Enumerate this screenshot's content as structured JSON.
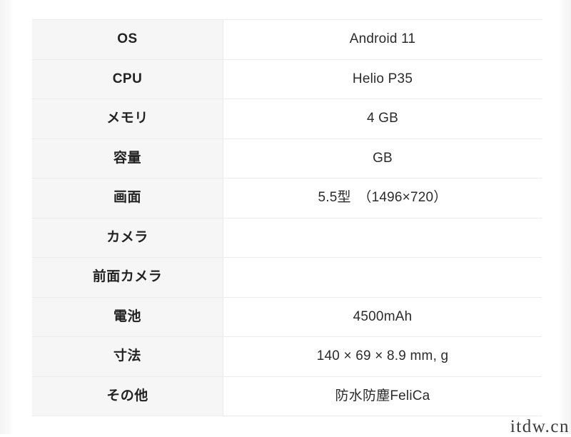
{
  "table": {
    "rows": [
      {
        "label": "OS",
        "value": "Android 11"
      },
      {
        "label": "CPU",
        "value": "Helio P35"
      },
      {
        "label": "メモリ",
        "value": "4 GB"
      },
      {
        "label": "容量",
        "value": "GB"
      },
      {
        "label": "画面",
        "value": "5.5型　（1496×720）"
      },
      {
        "label": "カメラ",
        "value": ""
      },
      {
        "label": "前面カメラ",
        "value": ""
      },
      {
        "label": "電池",
        "value": "4500mAh"
      },
      {
        "label": "寸法",
        "value": "140 × 69 × 8.9 mm, g"
      },
      {
        "label": "その他",
        "value": "防水防塵FeliCa"
      }
    ]
  },
  "watermark": {
    "text": "itdw.cn"
  },
  "colors": {
    "label_cell_background": "#f6f6f6",
    "value_cell_background": "#ffffff",
    "border": "#ececec",
    "label_text": "#222222",
    "value_text": "#2b2b2b"
  }
}
